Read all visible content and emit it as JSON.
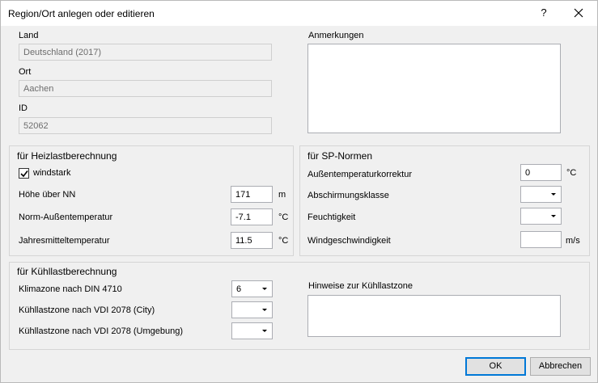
{
  "window": {
    "title": "Region/Ort anlegen oder editieren",
    "help_label": "?"
  },
  "general": {
    "land_label": "Land",
    "land_value": "Deutschland (2017)",
    "ort_label": "Ort",
    "ort_value": "Aachen",
    "id_label": "ID",
    "id_value": "52062",
    "anmerkungen_label": "Anmerkungen"
  },
  "heizlast": {
    "title": "für Heizlastberechnung",
    "windstark_label": "windstark",
    "windstark_checked": true,
    "hoehe_label": "Höhe über NN",
    "hoehe_value": "171",
    "hoehe_unit": "m",
    "norm_label": "Norm-Außentemperatur",
    "norm_value": "-7.1",
    "norm_unit": "°C",
    "jahres_label": "Jahresmitteltemperatur",
    "jahres_value": "11.5",
    "jahres_unit": "°C"
  },
  "sp": {
    "title": "für SP-Normen",
    "korrektur_label": "Außentemperaturkorrektur",
    "korrektur_value": "0",
    "korrektur_unit": "°C",
    "abschirmung_label": "Abschirmungsklasse",
    "abschirmung_value": "",
    "feuchtigkeit_label": "Feuchtigkeit",
    "feuchtigkeit_value": "",
    "wind_label": "Windgeschwindigkeit",
    "wind_value": "",
    "wind_unit": "m/s"
  },
  "kuehllast": {
    "title": "für Kühllastberechnung",
    "klimazone_label": "Klimazone nach DIN 4710",
    "klimazone_value": "6",
    "city_label": "Kühllastzone nach VDI 2078 (City)",
    "city_value": "",
    "umgebung_label": "Kühllastzone nach VDI 2078 (Umgebung)",
    "umgebung_value": "",
    "hinweise_label": "Hinweise zur Kühllastzone"
  },
  "buttons": {
    "ok": "OK",
    "cancel": "Abbrechen"
  },
  "colors": {
    "accent": "#0078d7",
    "dialog_bg": "#f0f0f0"
  }
}
